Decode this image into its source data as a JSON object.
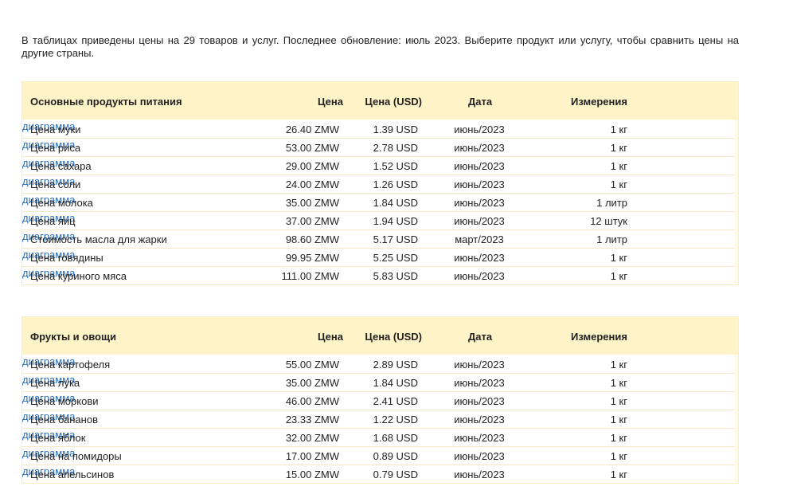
{
  "intro": "В таблицах приведены цены на 29 товаров и услуг. Последнее обновление: июль 2023. Выберите продукт или услугу, чтобы сравнить цены на другие страны.",
  "tables": [
    {
      "title": "Основные продукты питания",
      "headers": {
        "price": "Цена",
        "usd": "Цена (USD)",
        "date": "Дата",
        "unit": "Измерения"
      },
      "rows": [
        {
          "name": "Цена муки",
          "price": "26.40 ZMW",
          "usd": "1.39 USD",
          "date": "июнь/2023",
          "unit": "1 кг",
          "link": "диаграмма"
        },
        {
          "name": "Цена риса",
          "price": "53.00 ZMW",
          "usd": "2.78 USD",
          "date": "июнь/2023",
          "unit": "1 кг",
          "link": "диаграмма"
        },
        {
          "name": "Цена сахара",
          "price": "29.00 ZMW",
          "usd": "1.52 USD",
          "date": "июнь/2023",
          "unit": "1 кг",
          "link": "диаграмма"
        },
        {
          "name": "Цена соли",
          "price": "24.00 ZMW",
          "usd": "1.26 USD",
          "date": "июнь/2023",
          "unit": "1 кг",
          "link": "диаграмма"
        },
        {
          "name": "Цена молока",
          "price": "35.00 ZMW",
          "usd": "1.84 USD",
          "date": "июнь/2023",
          "unit": "1 литр",
          "link": "диаграмма"
        },
        {
          "name": "Цена яиц",
          "price": "37.00 ZMW",
          "usd": "1.94 USD",
          "date": "июнь/2023",
          "unit": "12 штук",
          "link": "диаграмма"
        },
        {
          "name": "Стоимость масла для жарки",
          "price": "98.60 ZMW",
          "usd": "5.17 USD",
          "date": "март/2023",
          "unit": "1 литр",
          "link": "диаграмма"
        },
        {
          "name": "Цена говядины",
          "price": "99.95 ZMW",
          "usd": "5.25 USD",
          "date": "июнь/2023",
          "unit": "1 кг",
          "link": "диаграмма"
        },
        {
          "name": "Цена куриного мяса",
          "price": "111.00 ZMW",
          "usd": "5.83 USD",
          "date": "июнь/2023",
          "unit": "1 кг",
          "link": "диаграмма"
        }
      ]
    },
    {
      "title": "Фрукты и овощи",
      "headers": {
        "price": "Цена",
        "usd": "Цена (USD)",
        "date": "Дата",
        "unit": "Измерения"
      },
      "rows": [
        {
          "name": "Цена картофеля",
          "price": "55.00 ZMW",
          "usd": "2.89 USD",
          "date": "июнь/2023",
          "unit": "1 кг",
          "link": "диаграмма"
        },
        {
          "name": "Цена лука",
          "price": "35.00 ZMW",
          "usd": "1.84 USD",
          "date": "июнь/2023",
          "unit": "1 кг",
          "link": "диаграмма"
        },
        {
          "name": "Цена моркови",
          "price": "46.00 ZMW",
          "usd": "2.41 USD",
          "date": "июнь/2023",
          "unit": "1 кг",
          "link": "диаграмма"
        },
        {
          "name": "Цена бананов",
          "price": "23.33 ZMW",
          "usd": "1.22 USD",
          "date": "июнь/2023",
          "unit": "1 кг",
          "link": "диаграмма"
        },
        {
          "name": "Цена яблок",
          "price": "32.00 ZMW",
          "usd": "1.68 USD",
          "date": "июнь/2023",
          "unit": "1 кг",
          "link": "диаграмма"
        },
        {
          "name": "Цена на помидоры",
          "price": "17.00 ZMW",
          "usd": "0.89 USD",
          "date": "июнь/2023",
          "unit": "1 кг",
          "link": "диаграмма"
        },
        {
          "name": "Цена апельсинов",
          "price": "15.00 ZMW",
          "usd": "0.79 USD",
          "date": "июнь/2023",
          "unit": "1 кг",
          "link": "диаграмма"
        }
      ]
    }
  ]
}
